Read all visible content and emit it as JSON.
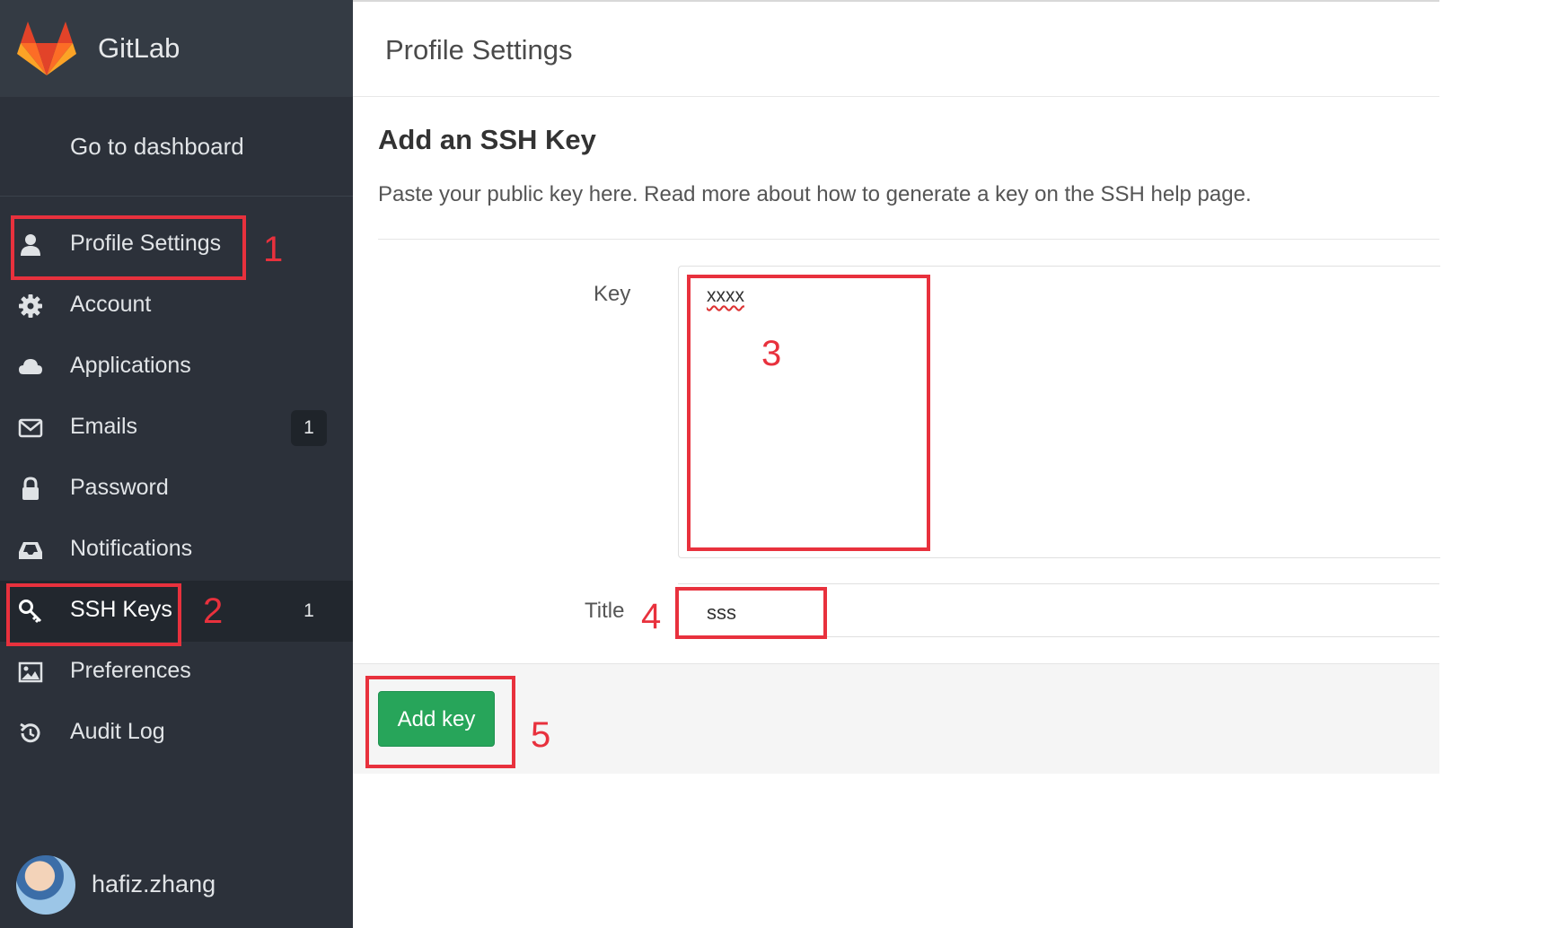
{
  "sidebar": {
    "brand": "GitLab",
    "dashboard_link": "Go to dashboard",
    "items": [
      {
        "label": "Profile Settings",
        "icon": "user-icon",
        "badge": null
      },
      {
        "label": "Account",
        "icon": "gear-icon",
        "badge": null
      },
      {
        "label": "Applications",
        "icon": "cloud-icon",
        "badge": null
      },
      {
        "label": "Emails",
        "icon": "envelope-icon",
        "badge": "1"
      },
      {
        "label": "Password",
        "icon": "lock-icon",
        "badge": null
      },
      {
        "label": "Notifications",
        "icon": "inbox-icon",
        "badge": null
      },
      {
        "label": "SSH Keys",
        "icon": "key-icon",
        "badge": "1",
        "active": true
      },
      {
        "label": "Preferences",
        "icon": "image-icon",
        "badge": null
      },
      {
        "label": "Audit Log",
        "icon": "history-icon",
        "badge": null
      }
    ],
    "user": {
      "name": "hafiz.zhang"
    }
  },
  "header": {
    "title": "Profile Settings"
  },
  "main": {
    "section_title": "Add an SSH Key",
    "section_description": "Paste your public key here. Read more about how to generate a key on the SSH help page.",
    "key_label": "Key",
    "key_value": "xxxx",
    "title_label": "Title",
    "title_value": "sss",
    "add_button": "Add key"
  },
  "annotations": [
    "1",
    "2",
    "3",
    "4",
    "5"
  ],
  "colors": {
    "sidebar_bg": "#2c313a",
    "sidebar_header_bg": "#343b44",
    "active_bg": "#22272e",
    "button_green": "#27a55a",
    "annotation_red": "#e8313d"
  }
}
